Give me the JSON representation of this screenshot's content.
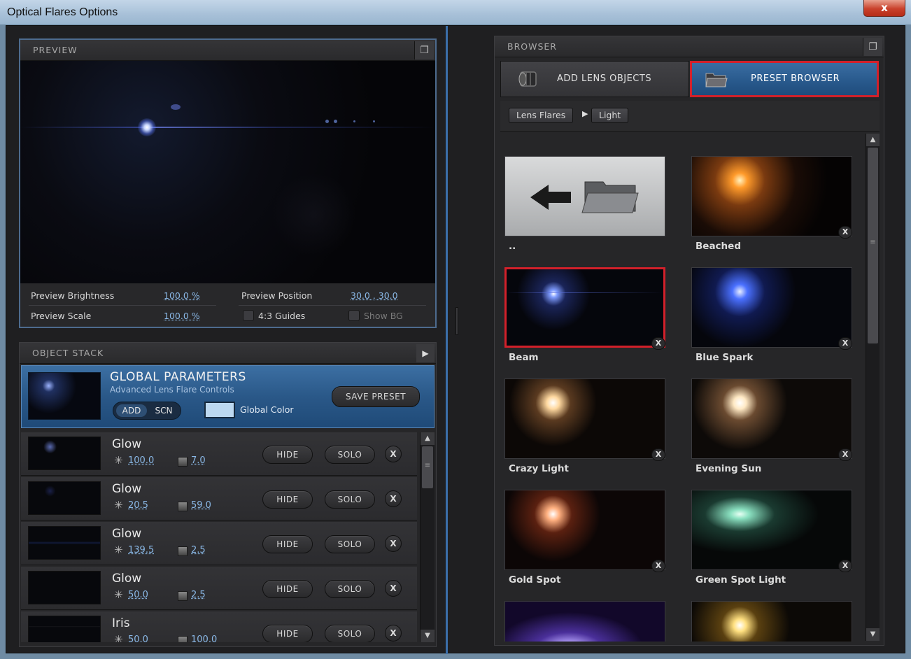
{
  "window": {
    "title": "Optical Flares Options",
    "close_label": "x"
  },
  "preview": {
    "header": "PREVIEW",
    "popout_icon": "popout-window-icon",
    "controls": {
      "brightness_label": "Preview Brightness",
      "brightness_value": "100.0 %",
      "position_label": "Preview Position",
      "position_value": "30.0 , 30.0",
      "scale_label": "Preview Scale",
      "scale_value": "100.0 %",
      "guides_label": "4:3 Guides",
      "showbg_label": "Show BG"
    }
  },
  "object_stack": {
    "header": "OBJECT STACK",
    "global": {
      "title": "GLOBAL PARAMETERS",
      "subtitle": "Advanced Lens Flare Controls",
      "add_label": "ADD",
      "scn_label": "SCN",
      "color_label": "Global Color",
      "color_hex": "#bcd8f0",
      "save_label": "SAVE PRESET"
    },
    "hide_label": "HIDE",
    "solo_label": "SOLO",
    "remove_label": "X",
    "items": [
      {
        "name": "Glow",
        "brightness": "100.0",
        "scale": "7.0"
      },
      {
        "name": "Glow",
        "brightness": "20.5",
        "scale": "59.0"
      },
      {
        "name": "Glow",
        "brightness": "139.5",
        "scale": "2.5"
      },
      {
        "name": "Glow",
        "brightness": "50.0",
        "scale": "2.5"
      },
      {
        "name": "Iris",
        "brightness": "50.0",
        "scale": "100.0"
      }
    ]
  },
  "browser": {
    "header": "BROWSER",
    "tabs": [
      {
        "label": "ADD LENS OBJECTS",
        "active": false
      },
      {
        "label": "PRESET BROWSER",
        "active": true
      }
    ],
    "breadcrumb": [
      "Lens Flares",
      "Light"
    ],
    "remove_label": "X",
    "presets": [
      {
        "label": "..",
        "kind": "back-folder"
      },
      {
        "label": "Beached"
      },
      {
        "label": "Beam",
        "selected": true
      },
      {
        "label": "Blue Spark"
      },
      {
        "label": "Crazy Light"
      },
      {
        "label": "Evening Sun"
      },
      {
        "label": "Gold Spot"
      },
      {
        "label": "Green Spot Light"
      },
      {
        "label": ""
      },
      {
        "label": ""
      }
    ]
  },
  "colors": {
    "accent_blue": "#2a5888",
    "selection_red": "#d3202a",
    "value_blue": "#8ab8e6"
  }
}
